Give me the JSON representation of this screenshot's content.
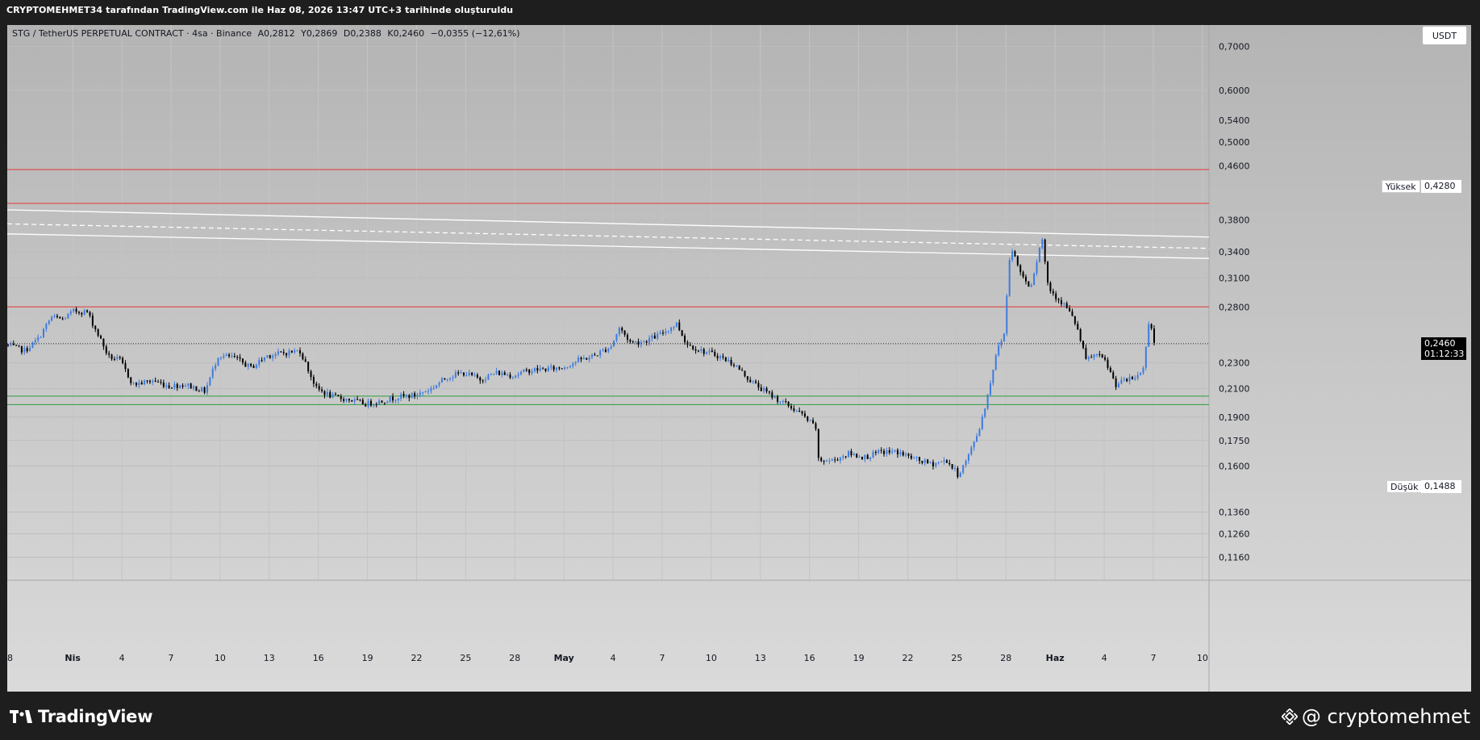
{
  "header": {
    "caption": "CRYPTOMEHMET34 tarafından TradingView.com ile Haz 08, 2026 13:47 UTC+3 tarihinde oluşturuldu"
  },
  "legend": {
    "symbol": "STG / TetherUS PERPETUAL CONTRACT · 4sa · Binance",
    "open": "A0,2812",
    "high": "Y0,2869",
    "low": "D0,2388",
    "close": "K0,2460",
    "change": "−0,0355 (−12,61%)"
  },
  "currency_button": {
    "label": "USDT"
  },
  "price_labels": {
    "high_tag": "Yüksek",
    "high_value": "0,4280",
    "low_tag": "Düşük",
    "low_value": "0,1488",
    "last_value": "0,2460",
    "countdown": "01:12:33"
  },
  "footer": {
    "brand": "TradingView",
    "author": "@ cryptomehmet"
  },
  "colors": {
    "up": "#3d7bdf",
    "down": "#000000",
    "resistance": "#e53935",
    "support": "#2e9e3e",
    "channel": "#ffffff",
    "background": "#c8c8c8"
  },
  "chart_data": {
    "type": "candlestick",
    "y_scale": "log",
    "ylim": [
      0.107,
      0.755
    ],
    "y_ticks": [
      0.7,
      0.6,
      0.54,
      0.5,
      0.46,
      0.38,
      0.34,
      0.31,
      0.28,
      0.23,
      0.21,
      0.19,
      0.175,
      0.16,
      0.136,
      0.126,
      0.116
    ],
    "y_tick_labels": [
      "0,7000",
      "0,6000",
      "0,5400",
      "0,5000",
      "0,4600",
      "0,3800",
      "0,3400",
      "0,3100",
      "0,2800",
      "0,2300",
      "0,2100",
      "0,1900",
      "0,1750",
      "0,1600",
      "0,1360",
      "0,1260",
      "0,1160"
    ],
    "x_ticks": [
      "28",
      "Nis",
      "4",
      "7",
      "10",
      "13",
      "16",
      "19",
      "22",
      "25",
      "28",
      "May",
      "4",
      "7",
      "10",
      "13",
      "16",
      "19",
      "22",
      "25",
      "28",
      "Haz",
      "4",
      "7",
      "10"
    ],
    "x_tick_days": [
      0,
      4,
      7,
      10,
      13,
      16,
      19,
      22,
      25,
      28,
      31,
      34,
      37,
      40,
      43,
      46,
      49,
      52,
      55,
      58,
      61,
      64,
      67,
      70,
      73
    ],
    "xlim_days": [
      0,
      73.4
    ],
    "candles_per_day": 6,
    "anchors": [
      [
        0,
        0.245
      ],
      [
        1.2,
        0.24
      ],
      [
        2.0,
        0.25
      ],
      [
        2.8,
        0.27
      ],
      [
        3.5,
        0.268
      ],
      [
        4.2,
        0.276
      ],
      [
        5.0,
        0.275
      ],
      [
        5.8,
        0.25
      ],
      [
        6.3,
        0.235
      ],
      [
        7.0,
        0.232
      ],
      [
        7.8,
        0.213
      ],
      [
        9.0,
        0.216
      ],
      [
        10.0,
        0.212
      ],
      [
        11.0,
        0.213
      ],
      [
        12.2,
        0.208
      ],
      [
        13.0,
        0.236
      ],
      [
        14.0,
        0.234
      ],
      [
        15.0,
        0.226
      ],
      [
        16.0,
        0.236
      ],
      [
        17.0,
        0.238
      ],
      [
        18.0,
        0.24
      ],
      [
        19.0,
        0.21
      ],
      [
        20.0,
        0.204
      ],
      [
        21.0,
        0.202
      ],
      [
        22.0,
        0.199
      ],
      [
        23.0,
        0.201
      ],
      [
        24.0,
        0.204
      ],
      [
        25.0,
        0.205
      ],
      [
        26.0,
        0.21
      ],
      [
        27.0,
        0.219
      ],
      [
        28.0,
        0.222
      ],
      [
        29.0,
        0.217
      ],
      [
        30.0,
        0.222
      ],
      [
        31.0,
        0.22
      ],
      [
        32.0,
        0.224
      ],
      [
        33.0,
        0.225
      ],
      [
        34.0,
        0.226
      ],
      [
        35.0,
        0.232
      ],
      [
        36.0,
        0.236
      ],
      [
        37.0,
        0.244
      ],
      [
        37.5,
        0.26
      ],
      [
        38.2,
        0.247
      ],
      [
        39.0,
        0.248
      ],
      [
        40.0,
        0.254
      ],
      [
        41.0,
        0.264
      ],
      [
        41.6,
        0.246
      ],
      [
        42.5,
        0.24
      ],
      [
        43.5,
        0.236
      ],
      [
        44.5,
        0.229
      ],
      [
        45.5,
        0.216
      ],
      [
        46.5,
        0.207
      ],
      [
        47.5,
        0.2
      ],
      [
        48.5,
        0.193
      ],
      [
        49.5,
        0.183
      ],
      [
        49.6,
        0.163
      ],
      [
        50.5,
        0.163
      ],
      [
        51.5,
        0.167
      ],
      [
        52.5,
        0.165
      ],
      [
        53.5,
        0.168
      ],
      [
        54.5,
        0.168
      ],
      [
        55.5,
        0.164
      ],
      [
        56.5,
        0.161
      ],
      [
        57.5,
        0.163
      ],
      [
        58.2,
        0.155
      ],
      [
        58.8,
        0.165
      ],
      [
        59.5,
        0.183
      ],
      [
        60.0,
        0.205
      ],
      [
        60.5,
        0.237
      ],
      [
        61.0,
        0.255
      ],
      [
        61.4,
        0.35
      ],
      [
        61.8,
        0.325
      ],
      [
        62.2,
        0.31
      ],
      [
        62.6,
        0.3
      ],
      [
        63.0,
        0.33
      ],
      [
        63.3,
        0.36
      ],
      [
        63.7,
        0.3
      ],
      [
        64.2,
        0.29
      ],
      [
        64.8,
        0.28
      ],
      [
        65.4,
        0.263
      ],
      [
        66.0,
        0.232
      ],
      [
        66.6,
        0.237
      ],
      [
        67.2,
        0.231
      ],
      [
        67.8,
        0.213
      ],
      [
        68.4,
        0.216
      ],
      [
        69.0,
        0.218
      ],
      [
        69.5,
        0.225
      ],
      [
        69.9,
        0.275
      ],
      [
        70.1,
        0.246
      ]
    ],
    "last_price": 0.246,
    "resistance_lines": [
      0.454,
      0.403,
      0.28
    ],
    "support_lines": [
      0.2045,
      0.1985
    ],
    "channel": {
      "upper": [
        [
          0,
          0.394
        ],
        [
          73.4,
          0.358
        ]
      ],
      "middle": [
        [
          0,
          0.375
        ],
        [
          73.4,
          0.344
        ]
      ],
      "lower": [
        [
          0,
          0.362
        ],
        [
          73.4,
          0.332
        ]
      ]
    }
  }
}
